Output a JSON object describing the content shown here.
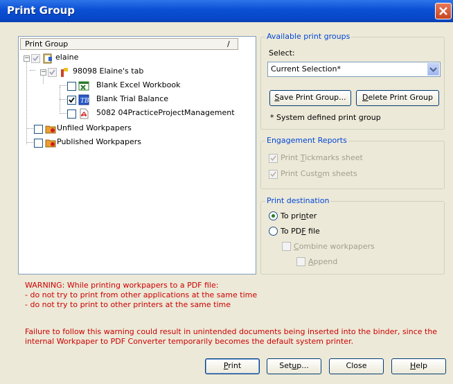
{
  "window": {
    "title": "Print Group"
  },
  "tree": {
    "header": "Print Group",
    "header_sort": "/",
    "nodes": {
      "root": "elaine",
      "tab": "98098 Elaine's tab",
      "excel": "Blank Excel Workbook",
      "trial": "Blank Trial Balance",
      "pdf": "5082 04PracticeProjectManagement",
      "unfiled": "Unfiled Workpapers",
      "published": "Published Workpapers"
    }
  },
  "available": {
    "legend": "Available print groups",
    "select_label": "Select:",
    "select_value": "Current Selection*",
    "save_button_pre": "S",
    "save_button_rest": "ave Print Group...",
    "delete_button_pre": "D",
    "delete_button_rest": "elete Print Group",
    "note": "* System defined print group"
  },
  "engagement": {
    "legend": "Engagement Reports",
    "tickmarks_pre": "Print ",
    "tickmarks_key": "T",
    "tickmarks_rest": "ickmarks sheet",
    "custom_pre": "Print Cust",
    "custom_key": "o",
    "custom_rest": "m sheets"
  },
  "destination": {
    "legend": "Print destination",
    "printer_pre": "To pri",
    "printer_key": "n",
    "printer_rest": "ter",
    "pdf_pre": "To PD",
    "pdf_key": "F",
    "pdf_rest": " file",
    "combine_key": "C",
    "combine_rest": "ombine workpapers",
    "append_key": "A",
    "append_rest": "ppend"
  },
  "warning": {
    "line1": "WARNING: While printing workpapers to a PDF file:",
    "line2": " - do not try to print from other applications at the same time",
    "line3": " - do not try to print to other printers at the same time",
    "line4": "Failure to follow this warning could result in unintended documents being inserted into the binder, since the",
    "line5": "internal Workpaper to PDF Converter temporarily becomes the default system printer."
  },
  "buttons": {
    "print_key": "P",
    "print_rest": "rint",
    "setup_pre": "Set",
    "setup_key": "u",
    "setup_rest": "p...",
    "close": "Close",
    "help_key": "H",
    "help_rest": "elp"
  },
  "colors": {
    "titlebar": "#0a4fd4",
    "warning": "#cc0000",
    "legend": "#0046d5",
    "dialog_bg": "#ece9d8"
  }
}
